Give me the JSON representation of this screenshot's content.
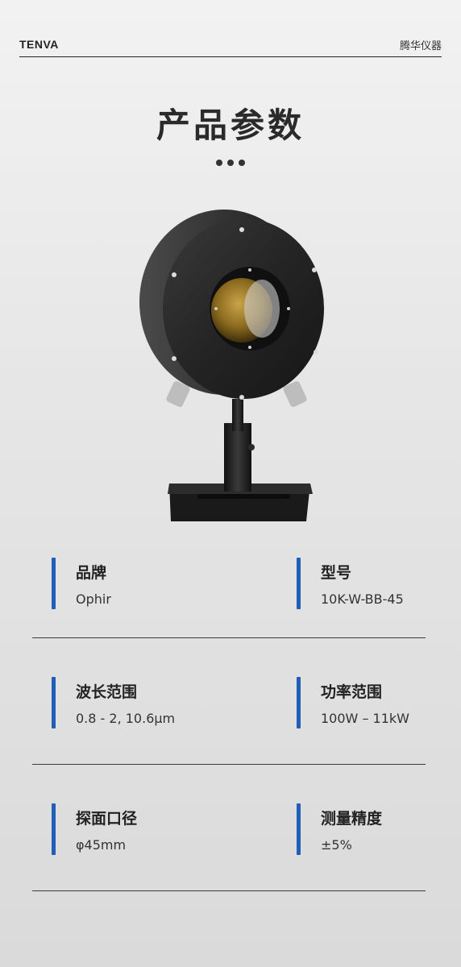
{
  "header": {
    "brand": "TENVA",
    "company": "腾华仪器"
  },
  "title": "产品参数",
  "specs": [
    {
      "label": "品牌",
      "value": "Ophir"
    },
    {
      "label": "型号",
      "value": "10K-W-BB-45"
    },
    {
      "label": "波长范围",
      "value": "0.8 - 2, 10.6μm"
    },
    {
      "label": "功率范围",
      "value": "100W – 11kW"
    },
    {
      "label": "探面口径",
      "value": "φ45mm"
    },
    {
      "label": "测量精度",
      "value": "±5%"
    }
  ],
  "colors": {
    "accent": "#1f5fb8",
    "background": "#e6e6e6",
    "text": "#222222"
  }
}
